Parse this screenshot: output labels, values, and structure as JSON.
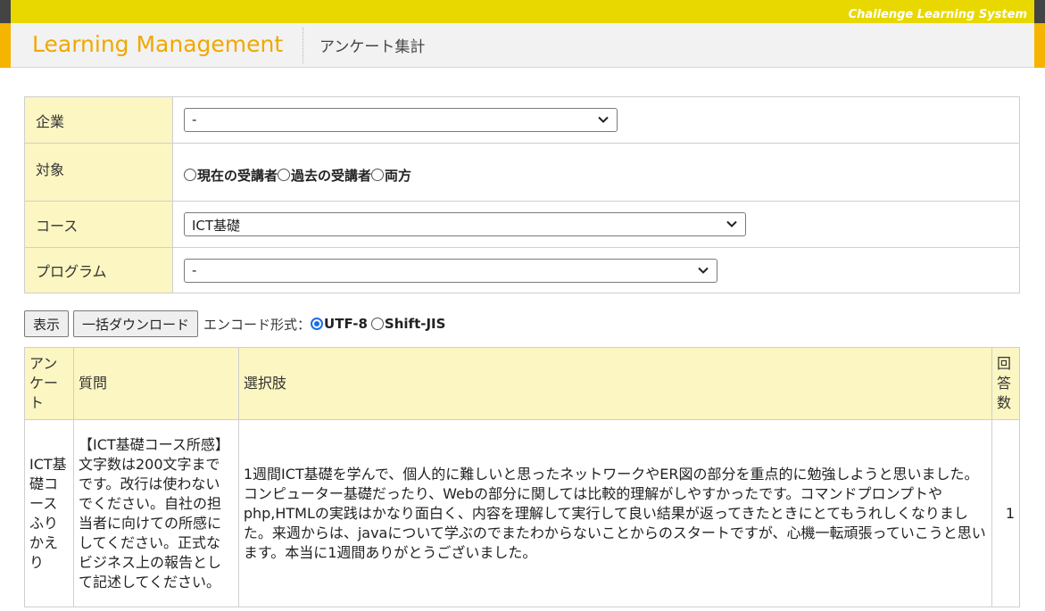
{
  "topbar": {
    "system_name": "Challenge Learning System"
  },
  "header": {
    "logo": "Learning Management",
    "page_title": "アンケート集計"
  },
  "form": {
    "company": {
      "label": "企業",
      "selected": "-"
    },
    "target": {
      "label": "対象",
      "options": [
        {
          "label": "現在の受講者",
          "checked": false
        },
        {
          "label": "過去の受講者",
          "checked": false
        },
        {
          "label": "両方",
          "checked": false
        }
      ]
    },
    "course": {
      "label": "コース",
      "selected": "ICT基礎"
    },
    "program": {
      "label": "プログラム",
      "selected": "-"
    }
  },
  "actions": {
    "show_label": "表示",
    "download_label": "一括ダウンロード",
    "encoding_label": "エンコード形式：",
    "encodings": [
      {
        "label": "UTF-8",
        "checked": true
      },
      {
        "label": "Shift-JIS",
        "checked": false
      }
    ]
  },
  "results": {
    "headers": {
      "survey": "アンケート",
      "question": "質問",
      "choices": "選択肢",
      "count": "回答数"
    },
    "rows": [
      {
        "survey": "ICT基礎コースふりかえり",
        "question": "【ICT基礎コース所感】文字数は200文字までです。改行は使わないでください。自社の担当者に向けての所感にしてください。正式なビジネス上の報告として記述してください。",
        "choice": "1週間ICT基礎を学んで、個人的に難しいと思ったネットワークやER図の部分を重点的に勉強しようと思いました。コンピューター基礎だったり、Webの部分に関しては比較的理解がしやすかったです。コマンドプロンプトやphp,HTMLの実践はかなり面白く、内容を理解して実行して良い結果が返ってきたときにとてもうれしくなりました。来週からは、javaについて学ぶのでまたわからないことからのスタートですが、心機一転頑張っていこうと思います。本当に1週間ありがとうございました。",
        "count": "1"
      }
    ]
  },
  "colors": {
    "topbar": "#e8d800",
    "accent": "#f5b400",
    "label_bg": "#fbf6c2",
    "radio_checked": "#1a6fe8"
  }
}
